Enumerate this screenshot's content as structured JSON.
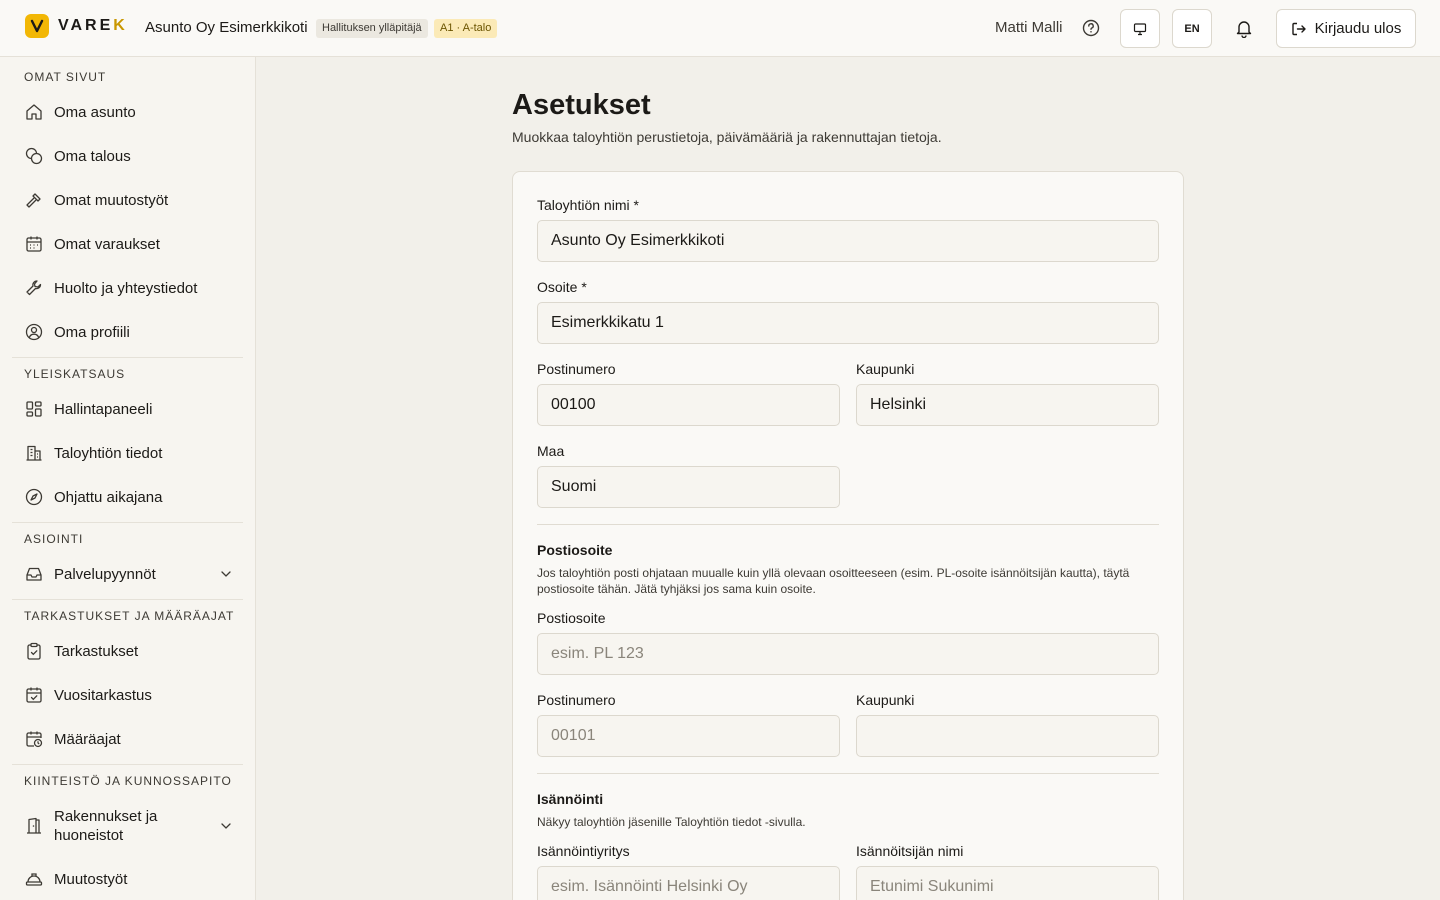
{
  "header": {
    "logo_prefix": "VARE",
    "logo_suffix": "K",
    "org_name": "Asunto Oy Esimerkkikoti",
    "role_badge": "Hallituksen ylläpitäjä",
    "apartment_badge": "A1 · A-talo",
    "user_name": "Matti Malli",
    "lang_label": "EN",
    "logout_label": "Kirjaudu ulos"
  },
  "sidebar": {
    "sections": [
      {
        "title": "OMAT SIVUT",
        "items": [
          "Oma asunto",
          "Oma talous",
          "Omat muutostyöt",
          "Omat varaukset",
          "Huolto ja yhteystiedot",
          "Oma profiili"
        ]
      },
      {
        "title": "YLEISKATSAUS",
        "items": [
          "Hallintapaneeli",
          "Taloyhtiön tiedot",
          "Ohjattu aikajana"
        ]
      },
      {
        "title": "ASIOINTI",
        "items": [
          "Palvelupyynnöt"
        ]
      },
      {
        "title": "TARKASTUKSET JA MÄÄRÄAJAT",
        "items": [
          "Tarkastukset",
          "Vuositarkastus",
          "Määräajat"
        ]
      },
      {
        "title": "KIINTEISTÖ JA KUNNOSSAPITO",
        "items": [
          "Rakennukset ja huoneistot",
          "Muutostyöt"
        ]
      }
    ]
  },
  "page": {
    "title": "Asetukset",
    "subtitle": "Muokkaa taloyhtiön perustietoja, päivämääriä ja rakennuttajan tietoja."
  },
  "form": {
    "name_label": "Taloyhtiön nimi *",
    "name_value": "Asunto Oy Esimerkkikoti",
    "address_label": "Osoite *",
    "address_value": "Esimerkkikatu 1",
    "postal_label": "Postinumero",
    "postal_value": "00100",
    "city_label": "Kaupunki",
    "city_value": "Helsinki",
    "country_label": "Maa",
    "country_value": "Suomi",
    "mail_heading": "Postiosoite",
    "mail_desc": "Jos taloyhtiön posti ohjataan muualle kuin yllä olevaan osoitteeseen (esim. PL-osoite isännöitsijän kautta), täytä postiosoite tähän. Jätä tyhjäksi jos sama kuin osoite.",
    "mail_address_label": "Postiosoite",
    "mail_address_placeholder": "esim. PL 123",
    "mail_postal_label": "Postinumero",
    "mail_postal_placeholder": "00101",
    "mail_city_label": "Kaupunki",
    "mail_city_value": "",
    "mgmt_heading": "Isännöinti",
    "mgmt_desc": "Näkyy taloyhtiön jäsenille Taloyhtiön tiedot -sivulla.",
    "mgmt_company_label": "Isännöintiyritys",
    "mgmt_company_placeholder": "esim. Isännöinti Helsinki Oy",
    "mgmt_manager_label": "Isännöitsijän nimi",
    "mgmt_manager_placeholder": "Etunimi Sukunimi"
  },
  "colors": {
    "accent": "#f2b705",
    "background": "#f2f0ea",
    "sidebar": "#f7f5f0"
  }
}
